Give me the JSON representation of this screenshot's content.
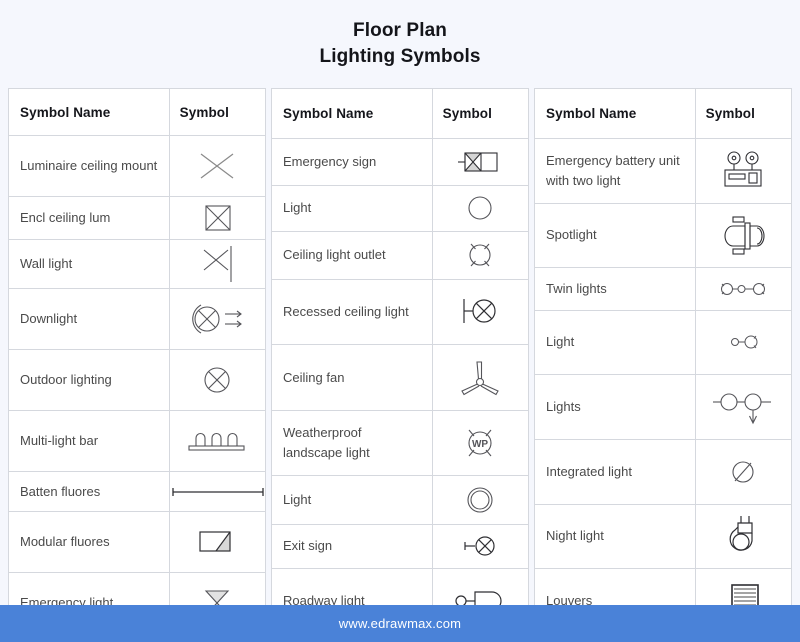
{
  "title": {
    "line1": "Floor Plan",
    "line2": "Lighting Symbols"
  },
  "headers": {
    "name": "Symbol Name",
    "symbol": "Symbol"
  },
  "tables": [
    {
      "id": "table-1",
      "rows": [
        {
          "name": "Luminaire ceiling mount",
          "symbol": "cross-x"
        },
        {
          "name": "Encl ceiling lum",
          "symbol": "square-x"
        },
        {
          "name": "Wall light",
          "symbol": "cross-x-wall-line"
        },
        {
          "name": "Downlight",
          "symbol": "circle-x-arc-arrows"
        },
        {
          "name": "Outdoor lighting",
          "symbol": "circle-x"
        },
        {
          "name": "Multi-light bar",
          "symbol": "bar-three-bulbs"
        },
        {
          "name": "Batten fluores",
          "symbol": "horizontal-line-ticks"
        },
        {
          "name": "Modular fluores",
          "symbol": "rect-diagonal-shaded"
        },
        {
          "name": "Emergency light",
          "symbol": "bowtie-hourglass"
        }
      ]
    },
    {
      "id": "table-2",
      "rows": [
        {
          "name": "Emergency sign",
          "symbol": "rect-x-shaded-lead"
        },
        {
          "name": "Light",
          "symbol": "circle-plain"
        },
        {
          "name": "Ceiling light outlet",
          "symbol": "circle-four-rays"
        },
        {
          "name": "Recessed ceiling light",
          "symbol": "circle-x-bracket"
        },
        {
          "name": "Ceiling fan",
          "symbol": "fan-three-blades"
        },
        {
          "name": "Weatherproof landscape light",
          "symbol": "circle-wp-rays"
        },
        {
          "name": "Light",
          "symbol": "double-circle"
        },
        {
          "name": "Exit sign",
          "symbol": "circle-x-stem"
        },
        {
          "name": "Roadway light",
          "symbol": "circle-rounded-rect"
        }
      ]
    },
    {
      "id": "table-3",
      "rows": [
        {
          "name": "Emergency battery unit with two light",
          "symbol": "battery-unit-two-heads"
        },
        {
          "name": "Spotlight",
          "symbol": "spotlight-body"
        },
        {
          "name": "Twin lights",
          "symbol": "twin-lamp-pair"
        },
        {
          "name": "Light",
          "symbol": "single-lamp-node"
        },
        {
          "name": "Lights",
          "symbol": "two-circles-arrow-down"
        },
        {
          "name": "Integrated light",
          "symbol": "circle-slash"
        },
        {
          "name": "Night light",
          "symbol": "plug-night-light"
        },
        {
          "name": "Louvers",
          "symbol": "louver-slats"
        }
      ]
    }
  ],
  "footer": {
    "url": "www.edrawmax.com"
  },
  "colors": {
    "background": "#f5f7fd",
    "footer_bar": "#4a82d8",
    "table_border": "#d5d8de",
    "title_text": "#14151a",
    "name_text": "#4a4a4a",
    "symbol_stroke": "#4a4a4a"
  }
}
